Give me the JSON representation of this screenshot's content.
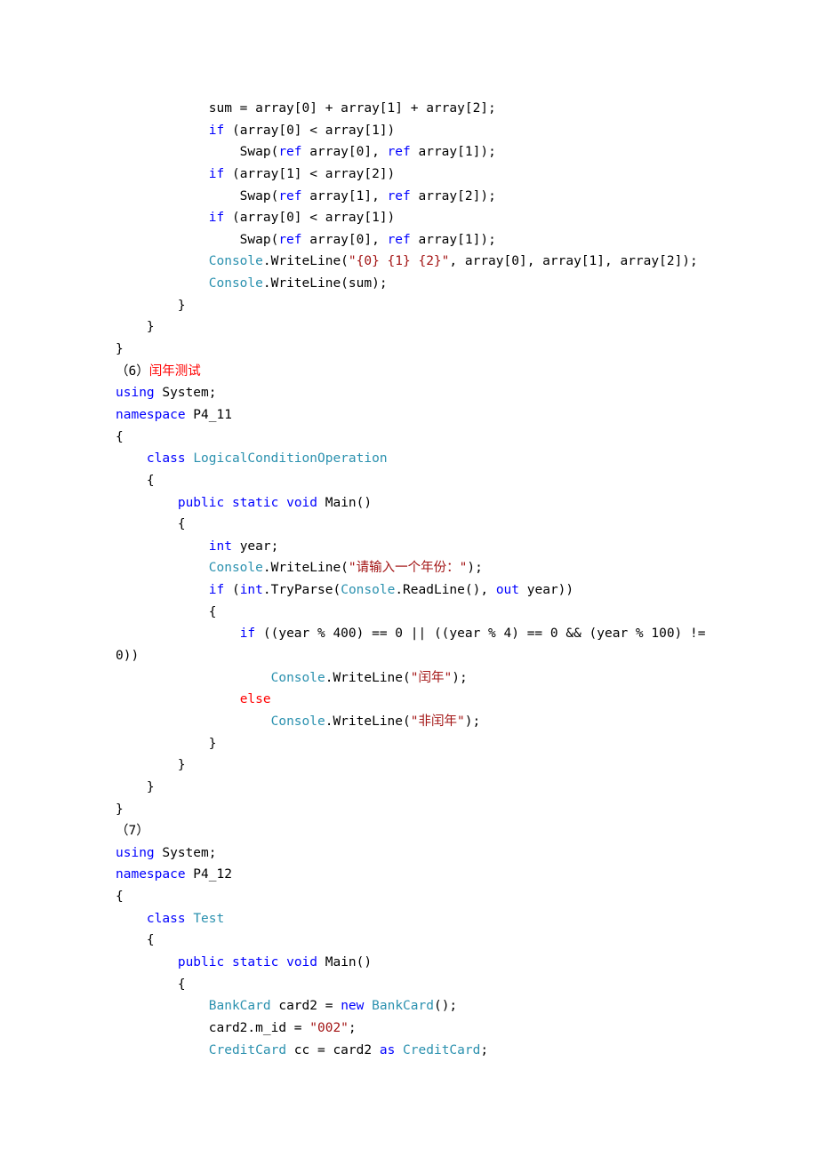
{
  "colors": {
    "blue": "#0000ff",
    "teal": "#2b91af",
    "red": "#ff0000",
    "black": "#000000",
    "brown": "#a31515"
  },
  "lines": [
    [
      {
        "t": "            sum = array[0] + array[1] + array[2];",
        "c": "black"
      }
    ],
    [
      {
        "t": "            ",
        "c": "black"
      },
      {
        "t": "if",
        "c": "blue"
      },
      {
        "t": " (array[0] < array[1])",
        "c": "black"
      }
    ],
    [
      {
        "t": "                Swap(",
        "c": "black"
      },
      {
        "t": "ref",
        "c": "blue"
      },
      {
        "t": " array[0], ",
        "c": "black"
      },
      {
        "t": "ref",
        "c": "blue"
      },
      {
        "t": " array[1]);",
        "c": "black"
      }
    ],
    [
      {
        "t": "            ",
        "c": "black"
      },
      {
        "t": "if",
        "c": "blue"
      },
      {
        "t": " (array[1] < array[2])",
        "c": "black"
      }
    ],
    [
      {
        "t": "                Swap(",
        "c": "black"
      },
      {
        "t": "ref",
        "c": "blue"
      },
      {
        "t": " array[1], ",
        "c": "black"
      },
      {
        "t": "ref",
        "c": "blue"
      },
      {
        "t": " array[2]);",
        "c": "black"
      }
    ],
    [
      {
        "t": "            ",
        "c": "black"
      },
      {
        "t": "if",
        "c": "blue"
      },
      {
        "t": " (array[0] < array[1])",
        "c": "black"
      }
    ],
    [
      {
        "t": "                Swap(",
        "c": "black"
      },
      {
        "t": "ref",
        "c": "blue"
      },
      {
        "t": " array[0], ",
        "c": "black"
      },
      {
        "t": "ref",
        "c": "blue"
      },
      {
        "t": " array[1]);",
        "c": "black"
      }
    ],
    [
      {
        "t": "            ",
        "c": "black"
      },
      {
        "t": "Console",
        "c": "teal"
      },
      {
        "t": ".WriteLine(",
        "c": "black"
      },
      {
        "t": "\"{0} {1} {2}\"",
        "c": "brown"
      },
      {
        "t": ", array[0], array[1], array[2]);",
        "c": "black"
      }
    ],
    [
      {
        "t": "            ",
        "c": "black"
      },
      {
        "t": "Console",
        "c": "teal"
      },
      {
        "t": ".WriteLine(sum);",
        "c": "black"
      }
    ],
    [
      {
        "t": "        }",
        "c": "black"
      }
    ],
    [
      {
        "t": "    }",
        "c": "black"
      }
    ],
    [
      {
        "t": "}",
        "c": "black"
      }
    ],
    [
      {
        "t": "（6）",
        "c": "black"
      },
      {
        "t": "闰年测试",
        "c": "red"
      }
    ],
    [
      {
        "t": "using",
        "c": "blue"
      },
      {
        "t": " System;",
        "c": "black"
      }
    ],
    [
      {
        "t": "namespace",
        "c": "blue"
      },
      {
        "t": " P4_11",
        "c": "black"
      }
    ],
    [
      {
        "t": "{",
        "c": "black"
      }
    ],
    [
      {
        "t": "    ",
        "c": "black"
      },
      {
        "t": "class",
        "c": "blue"
      },
      {
        "t": " ",
        "c": "black"
      },
      {
        "t": "LogicalConditionOperation",
        "c": "teal"
      }
    ],
    [
      {
        "t": "    {",
        "c": "black"
      }
    ],
    [
      {
        "t": "        ",
        "c": "black"
      },
      {
        "t": "public",
        "c": "blue"
      },
      {
        "t": " ",
        "c": "black"
      },
      {
        "t": "static",
        "c": "blue"
      },
      {
        "t": " ",
        "c": "black"
      },
      {
        "t": "void",
        "c": "blue"
      },
      {
        "t": " Main()",
        "c": "black"
      }
    ],
    [
      {
        "t": "        {",
        "c": "black"
      }
    ],
    [
      {
        "t": "            ",
        "c": "black"
      },
      {
        "t": "int",
        "c": "blue"
      },
      {
        "t": " year;",
        "c": "black"
      }
    ],
    [
      {
        "t": "            ",
        "c": "black"
      },
      {
        "t": "Console",
        "c": "teal"
      },
      {
        "t": ".WriteLine(",
        "c": "black"
      },
      {
        "t": "\"请输入一个年份：\"",
        "c": "brown"
      },
      {
        "t": ");",
        "c": "black"
      }
    ],
    [
      {
        "t": "            ",
        "c": "black"
      },
      {
        "t": "if",
        "c": "blue"
      },
      {
        "t": " (",
        "c": "black"
      },
      {
        "t": "int",
        "c": "blue"
      },
      {
        "t": ".TryParse(",
        "c": "black"
      },
      {
        "t": "Console",
        "c": "teal"
      },
      {
        "t": ".ReadLine(), ",
        "c": "black"
      },
      {
        "t": "out",
        "c": "blue"
      },
      {
        "t": " year))",
        "c": "black"
      }
    ],
    [
      {
        "t": "            {",
        "c": "black"
      }
    ],
    [
      {
        "t": "                ",
        "c": "black"
      },
      {
        "t": "if",
        "c": "blue"
      },
      {
        "t": " ((year % 400) == 0 || ((year % 4) == 0 && (year % 100) !=",
        "c": "black"
      }
    ],
    [
      {
        "t": "0))",
        "c": "black"
      }
    ],
    [
      {
        "t": "                    ",
        "c": "black"
      },
      {
        "t": "Console",
        "c": "teal"
      },
      {
        "t": ".WriteLine(",
        "c": "black"
      },
      {
        "t": "\"闰年\"",
        "c": "brown"
      },
      {
        "t": ");",
        "c": "black"
      }
    ],
    [
      {
        "t": "                ",
        "c": "black"
      },
      {
        "t": "else",
        "c": "red"
      }
    ],
    [
      {
        "t": "                    ",
        "c": "black"
      },
      {
        "t": "Console",
        "c": "teal"
      },
      {
        "t": ".WriteLine(",
        "c": "black"
      },
      {
        "t": "\"非闰年\"",
        "c": "brown"
      },
      {
        "t": ");",
        "c": "black"
      }
    ],
    [
      {
        "t": "            }",
        "c": "black"
      }
    ],
    [
      {
        "t": "        }",
        "c": "black"
      }
    ],
    [
      {
        "t": "    }",
        "c": "black"
      }
    ],
    [
      {
        "t": "}",
        "c": "black"
      }
    ],
    [
      {
        "t": "（7）",
        "c": "black"
      }
    ],
    [
      {
        "t": "using",
        "c": "blue"
      },
      {
        "t": " System;",
        "c": "black"
      }
    ],
    [
      {
        "t": "namespace",
        "c": "blue"
      },
      {
        "t": " P4_12",
        "c": "black"
      }
    ],
    [
      {
        "t": "{",
        "c": "black"
      }
    ],
    [
      {
        "t": "    ",
        "c": "black"
      },
      {
        "t": "class",
        "c": "blue"
      },
      {
        "t": " ",
        "c": "black"
      },
      {
        "t": "Test",
        "c": "teal"
      }
    ],
    [
      {
        "t": "    {",
        "c": "black"
      }
    ],
    [
      {
        "t": "        ",
        "c": "black"
      },
      {
        "t": "public",
        "c": "blue"
      },
      {
        "t": " ",
        "c": "black"
      },
      {
        "t": "static",
        "c": "blue"
      },
      {
        "t": " ",
        "c": "black"
      },
      {
        "t": "void",
        "c": "blue"
      },
      {
        "t": " Main()",
        "c": "black"
      }
    ],
    [
      {
        "t": "        {",
        "c": "black"
      }
    ],
    [
      {
        "t": "            ",
        "c": "black"
      },
      {
        "t": "BankCard",
        "c": "teal"
      },
      {
        "t": " card2 = ",
        "c": "black"
      },
      {
        "t": "new",
        "c": "blue"
      },
      {
        "t": " ",
        "c": "black"
      },
      {
        "t": "BankCard",
        "c": "teal"
      },
      {
        "t": "();",
        "c": "black"
      }
    ],
    [
      {
        "t": "            card2.m_id = ",
        "c": "black"
      },
      {
        "t": "\"002\"",
        "c": "brown"
      },
      {
        "t": ";",
        "c": "black"
      }
    ],
    [
      {
        "t": "            ",
        "c": "black"
      },
      {
        "t": "CreditCard",
        "c": "teal"
      },
      {
        "t": " cc = card2 ",
        "c": "black"
      },
      {
        "t": "as",
        "c": "blue"
      },
      {
        "t": " ",
        "c": "black"
      },
      {
        "t": "CreditCard",
        "c": "teal"
      },
      {
        "t": ";",
        "c": "black"
      }
    ]
  ]
}
